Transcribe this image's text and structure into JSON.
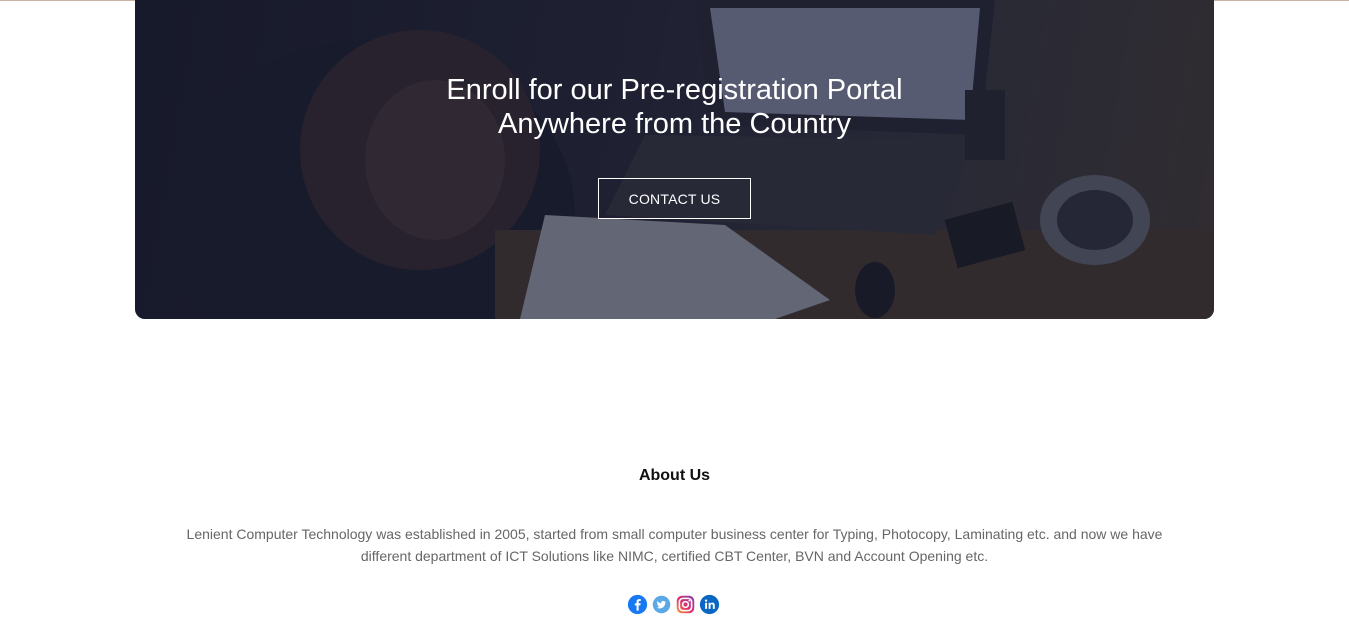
{
  "hero": {
    "title_line1": "Enroll for our Pre-registration Portal",
    "title_line2": "Anywhere from the Country",
    "cta_label": "CONTACT US"
  },
  "about": {
    "title": "About Us",
    "text": "Lenient Computer Technology was established in 2005, started from small computer business center for Typing, Photocopy, Laminating etc. and now we have different department of ICT Solutions like NIMC, certified CBT Center, BVN and Account Opening etc."
  },
  "social": [
    {
      "icon": "facebook-icon",
      "color": "#1877f2"
    },
    {
      "icon": "twitter-icon",
      "color": "#5aa9e6"
    },
    {
      "icon": "instagram-icon",
      "color": "#c13584"
    },
    {
      "icon": "linkedin-icon",
      "color": "#0a66c2"
    }
  ]
}
